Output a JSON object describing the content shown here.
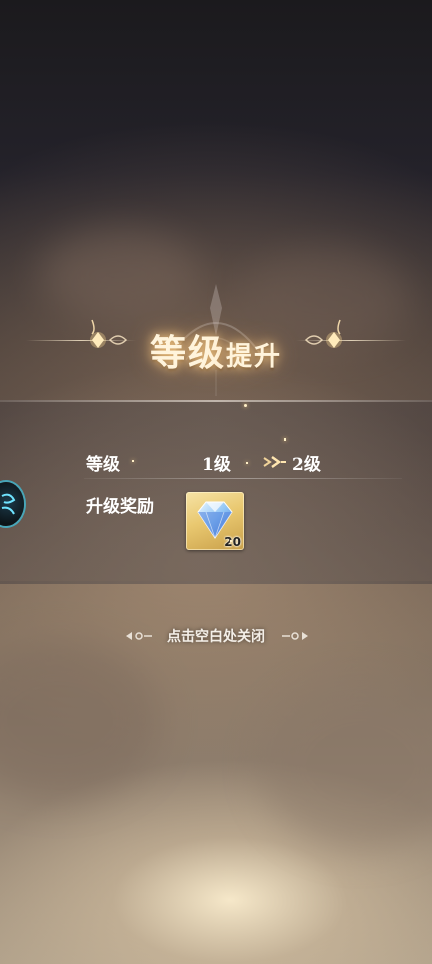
{
  "popup": {
    "title_main": "等级",
    "title_sub": "提升"
  },
  "level_row": {
    "label": "等级",
    "from": "1级",
    "to": "2级"
  },
  "reward_row": {
    "label": "升级奖励",
    "items": [
      {
        "icon": "diamond-icon",
        "count": "20"
      }
    ]
  },
  "close_hint": "点击空白处关闭",
  "colors": {
    "title_glow": "#ffd28c",
    "reward_bg": "#e9c870",
    "side_avatar_ring": "#3cc8e6"
  }
}
